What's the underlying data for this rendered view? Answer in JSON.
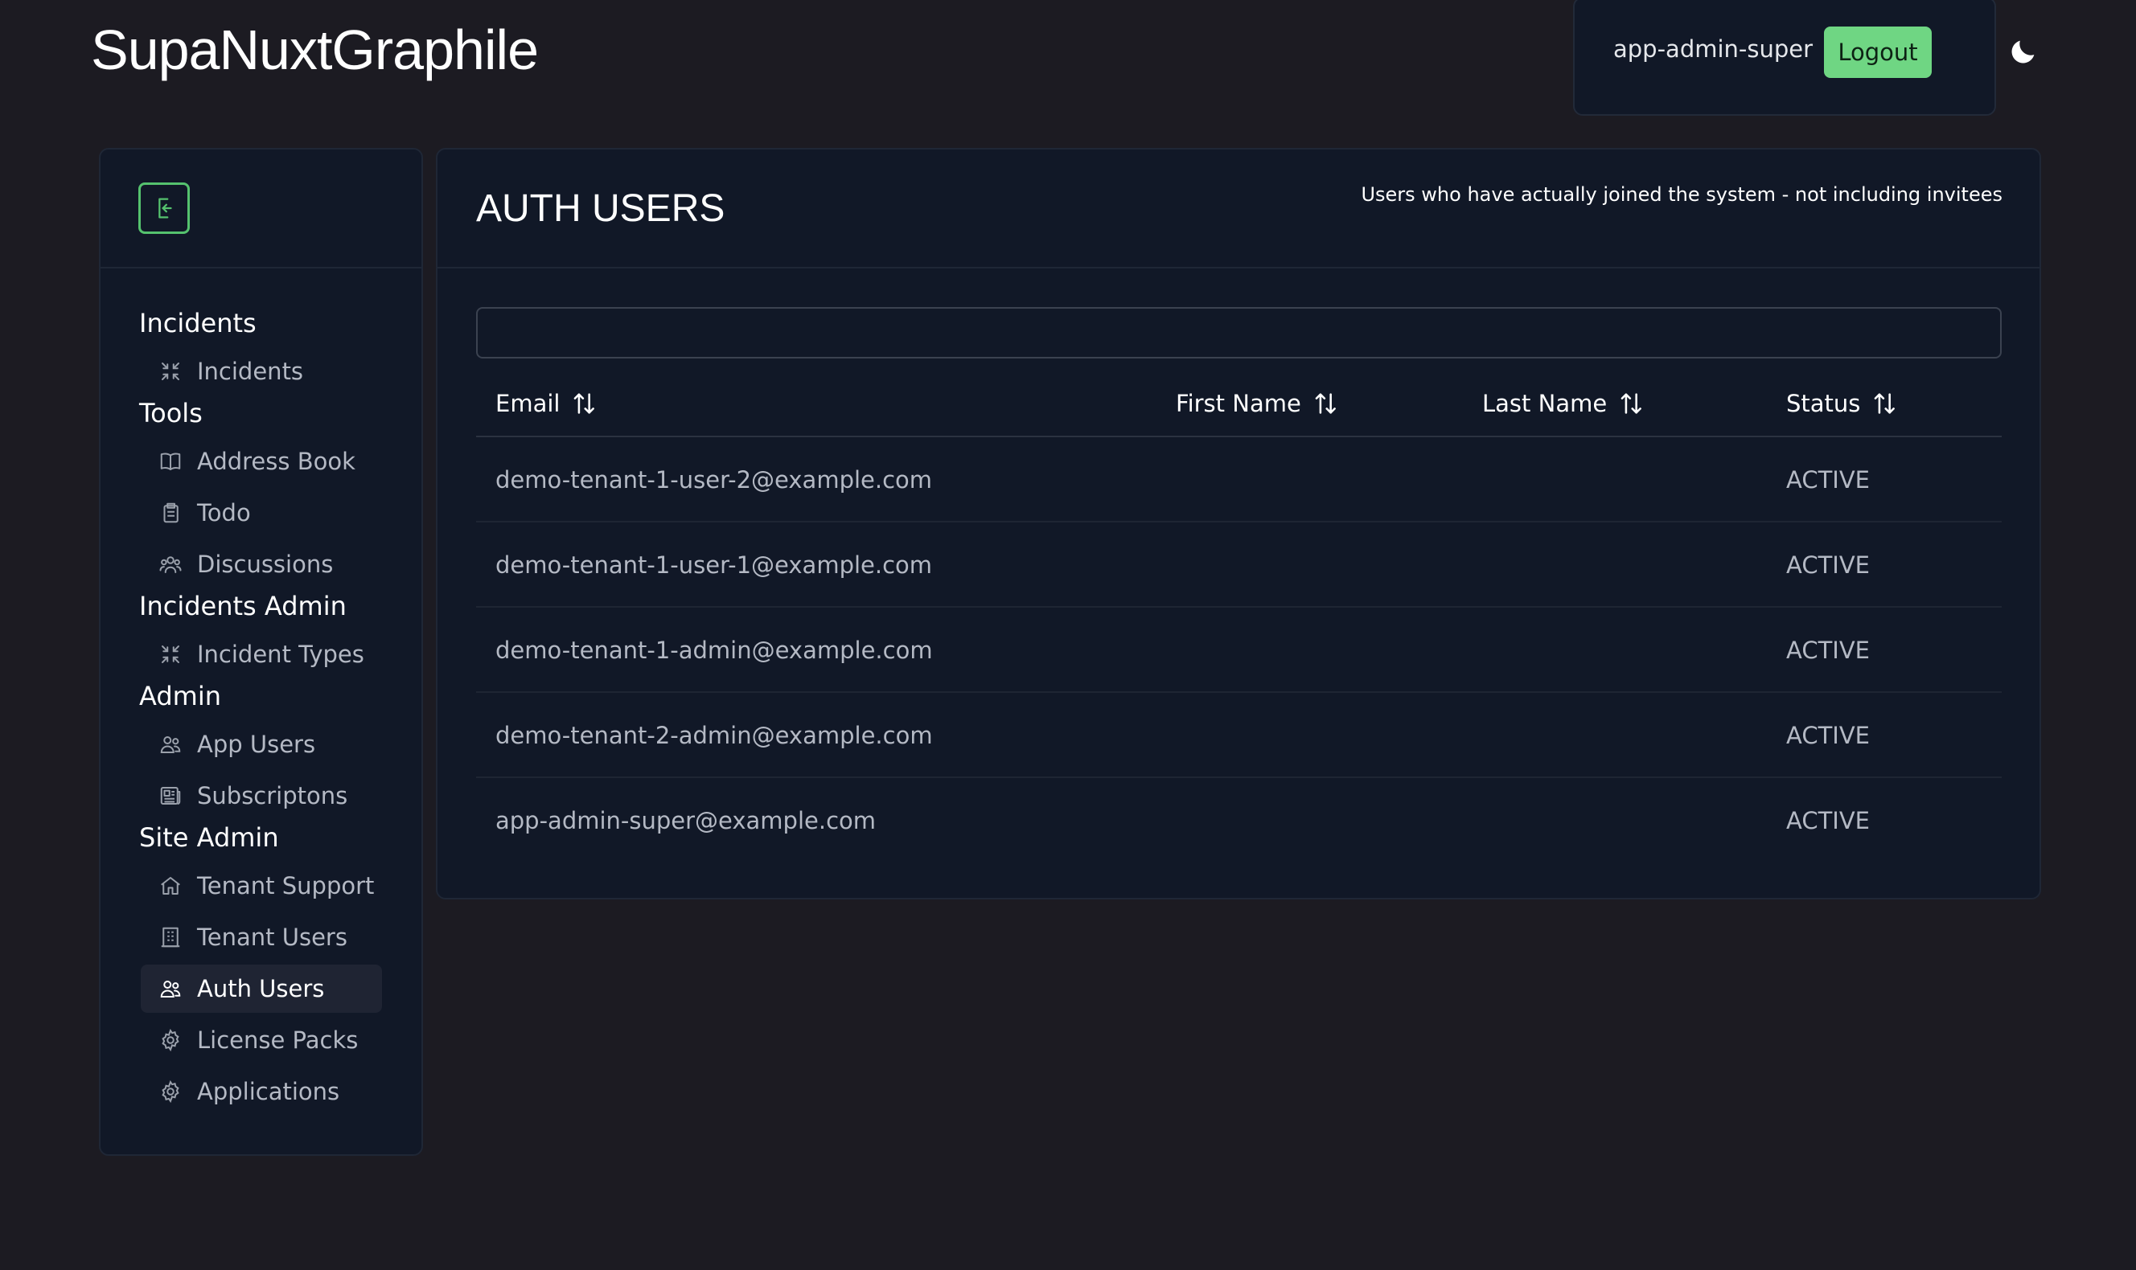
{
  "header": {
    "app_title": "SupaNuxtGraphile",
    "username": "app-admin-super",
    "logout_label": "Logout"
  },
  "sidebar": {
    "sections": [
      {
        "title": "Incidents",
        "items": [
          {
            "label": "Incidents",
            "icon": "arrows-collapse-icon"
          }
        ]
      },
      {
        "title": "Tools",
        "items": [
          {
            "label": "Address Book",
            "icon": "book-icon"
          },
          {
            "label": "Todo",
            "icon": "clipboard-icon"
          },
          {
            "label": "Discussions",
            "icon": "users-group-icon"
          }
        ]
      },
      {
        "title": "Incidents Admin",
        "items": [
          {
            "label": "Incident Types",
            "icon": "arrows-collapse-icon"
          }
        ]
      },
      {
        "title": "Admin",
        "items": [
          {
            "label": "App Users",
            "icon": "users-icon"
          },
          {
            "label": "Subscriptons",
            "icon": "newspaper-icon"
          }
        ]
      },
      {
        "title": "Site Admin",
        "items": [
          {
            "label": "Tenant Support",
            "icon": "home-icon"
          },
          {
            "label": "Tenant Users",
            "icon": "building-icon"
          },
          {
            "label": "Auth Users",
            "icon": "users-icon",
            "active": true
          },
          {
            "label": "License Packs",
            "icon": "gear-icon"
          },
          {
            "label": "Applications",
            "icon": "gear-icon"
          }
        ]
      }
    ]
  },
  "main": {
    "title": "AUTH USERS",
    "description": "Users who have actually joined the system - not including invitees",
    "search_value": "",
    "columns": [
      "Email",
      "First Name",
      "Last Name",
      "Status"
    ],
    "rows": [
      {
        "email": "demo-tenant-1-user-2@example.com",
        "first_name": "",
        "last_name": "",
        "status": "ACTIVE"
      },
      {
        "email": "demo-tenant-1-user-1@example.com",
        "first_name": "",
        "last_name": "",
        "status": "ACTIVE"
      },
      {
        "email": "demo-tenant-1-admin@example.com",
        "first_name": "",
        "last_name": "",
        "status": "ACTIVE"
      },
      {
        "email": "demo-tenant-2-admin@example.com",
        "first_name": "",
        "last_name": "",
        "status": "ACTIVE"
      },
      {
        "email": "app-admin-super@example.com",
        "first_name": "",
        "last_name": "",
        "status": "ACTIVE"
      }
    ]
  },
  "colors": {
    "background": "#1c1b22",
    "panel": "#111827",
    "accent": "#6fd683"
  }
}
